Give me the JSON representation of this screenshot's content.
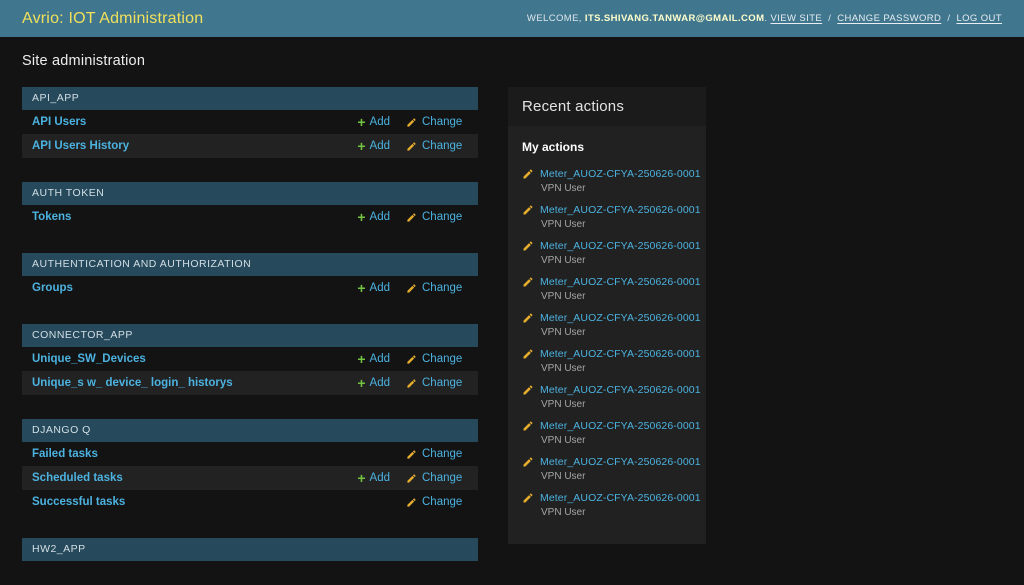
{
  "header": {
    "title": "Avrio: IOT Administration",
    "welcome_prefix": "WELCOME,",
    "username": "ITS.SHIVANG.TANWAR@GMAIL.COM",
    "welcome_suffix": ".",
    "link_separator": "/",
    "links": [
      {
        "label": "VIEW SITE"
      },
      {
        "label": "CHANGE PASSWORD"
      },
      {
        "label": "LOG OUT"
      }
    ]
  },
  "page_title": "Site administration",
  "labels": {
    "add": "Add",
    "change": "Change"
  },
  "modules": [
    {
      "caption": "API_APP",
      "rows": [
        {
          "name": "API Users",
          "add": true,
          "change": true
        },
        {
          "name": "API Users History",
          "add": true,
          "change": true
        }
      ]
    },
    {
      "caption": "AUTH TOKEN",
      "rows": [
        {
          "name": "Tokens",
          "add": true,
          "change": true
        }
      ]
    },
    {
      "caption": "AUTHENTICATION AND AUTHORIZATION",
      "rows": [
        {
          "name": "Groups",
          "add": true,
          "change": true
        }
      ]
    },
    {
      "caption": "CONNECTOR_APP",
      "rows": [
        {
          "name": "Unique_SW_Devices",
          "add": true,
          "change": true
        },
        {
          "name": "Unique_s w_ device_ login_ historys",
          "add": true,
          "change": true
        }
      ]
    },
    {
      "caption": "DJANGO Q",
      "rows": [
        {
          "name": "Failed tasks",
          "add": false,
          "change": true
        },
        {
          "name": "Scheduled tasks",
          "add": true,
          "change": true
        },
        {
          "name": "Successful tasks",
          "add": false,
          "change": true
        }
      ]
    },
    {
      "caption": "HW2_APP",
      "rows": []
    }
  ],
  "recent_actions": {
    "title": "Recent actions",
    "subtitle": "My actions",
    "items": [
      {
        "name": "Meter_AUOZ-CFYA-250626-0001",
        "type": "VPN User"
      },
      {
        "name": "Meter_AUOZ-CFYA-250626-0001",
        "type": "VPN User"
      },
      {
        "name": "Meter_AUOZ-CFYA-250626-0001",
        "type": "VPN User"
      },
      {
        "name": "Meter_AUOZ-CFYA-250626-0001",
        "type": "VPN User"
      },
      {
        "name": "Meter_AUOZ-CFYA-250626-0001",
        "type": "VPN User"
      },
      {
        "name": "Meter_AUOZ-CFYA-250626-0001",
        "type": "VPN User"
      },
      {
        "name": "Meter_AUOZ-CFYA-250626-0001",
        "type": "VPN User"
      },
      {
        "name": "Meter_AUOZ-CFYA-250626-0001",
        "type": "VPN User"
      },
      {
        "name": "Meter_AUOZ-CFYA-250626-0001",
        "type": "VPN User"
      },
      {
        "name": "Meter_AUOZ-CFYA-250626-0001",
        "type": "VPN User"
      }
    ]
  },
  "colors": {
    "header_bg": "#40778f",
    "brand": "#f1e05a",
    "caption_bg": "#26495c",
    "caption_fg": "#d3dfe5",
    "link": "#4cb2e0",
    "add_green": "#72c341",
    "pencil_yellow": "#e3ac2d",
    "page_bg": "#131313",
    "panel_bg": "#212121",
    "panel_head_bg": "#1b1b1b",
    "alt_row_bg": "#222222"
  }
}
